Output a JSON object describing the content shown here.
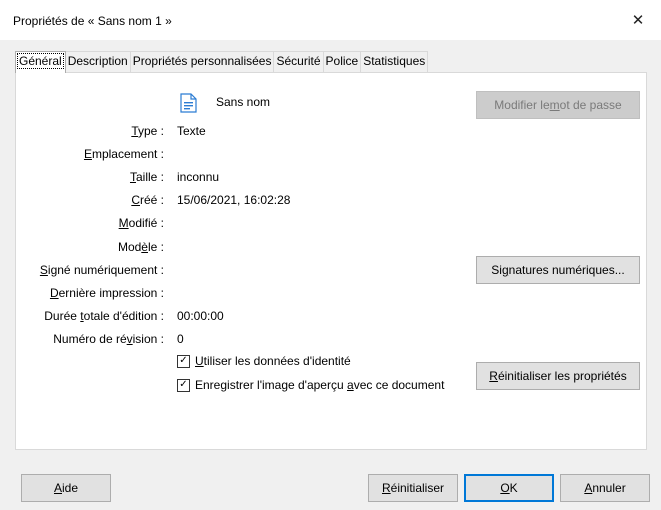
{
  "window": {
    "title": "Propriétés de « Sans nom 1 »",
    "close_icon": "close-icon"
  },
  "tabs": [
    {
      "label": "Général",
      "active": true
    },
    {
      "label": "Description"
    },
    {
      "label": "Propriétés personnalisées"
    },
    {
      "label": "Sécurité"
    },
    {
      "label": "Police"
    },
    {
      "label": "Statistiques"
    }
  ],
  "general": {
    "doc_name": "Sans nom",
    "rows": [
      {
        "pre": "",
        "key": "T",
        "post": "ype :",
        "value": "Texte"
      },
      {
        "pre": "",
        "key": "E",
        "post": "mplacement :",
        "value": ""
      },
      {
        "pre": "",
        "key": "T",
        "post": "aille :",
        "value": "inconnu"
      },
      {
        "pre": "",
        "key": "C",
        "post": "réé :",
        "value": "15/06/2021, 16:02:28"
      },
      {
        "pre": "",
        "key": "M",
        "post": "odifié :",
        "value": ""
      },
      {
        "pre": "Mod",
        "key": "è",
        "post": "le :",
        "value": ""
      },
      {
        "pre": "",
        "key": "S",
        "post": "igné numériquement :",
        "value": ""
      },
      {
        "pre": "",
        "key": "D",
        "post": "ernière impression :",
        "value": ""
      },
      {
        "pre": "Durée ",
        "key": "t",
        "post": "otale d'édition :",
        "value": "00:00:00"
      },
      {
        "pre": "Numéro de ré",
        "key": "v",
        "post": "ision :",
        "value": "0"
      }
    ],
    "checkboxes": [
      {
        "pre": "",
        "key": "U",
        "post": "tiliser les données d'identité",
        "checked": true
      },
      {
        "pre": "Enregistrer l'image d'aperçu ",
        "key": "a",
        "post": "vec ce document",
        "checked": true
      }
    ],
    "buttons": {
      "change_password": {
        "pre": "Modifier le ",
        "key": "m",
        "post": "ot de passe"
      },
      "digital_signatures": {
        "pre": "Si",
        "key": "g",
        "post": "natures numériques..."
      },
      "reset_properties": {
        "pre": "",
        "key": "R",
        "post": "éinitialiser les propriétés"
      }
    }
  },
  "footer": {
    "help": {
      "pre": "",
      "key": "A",
      "post": "ide"
    },
    "reset": {
      "pre": "",
      "key": "R",
      "post": "éinitialiser"
    },
    "ok": {
      "pre": "",
      "key": "O",
      "post": "K"
    },
    "cancel": {
      "pre": "",
      "key": "A",
      "post": "nnuler"
    }
  },
  "colors": {
    "accent": "#0078d7",
    "icon_blue": "#2b7cd3"
  }
}
